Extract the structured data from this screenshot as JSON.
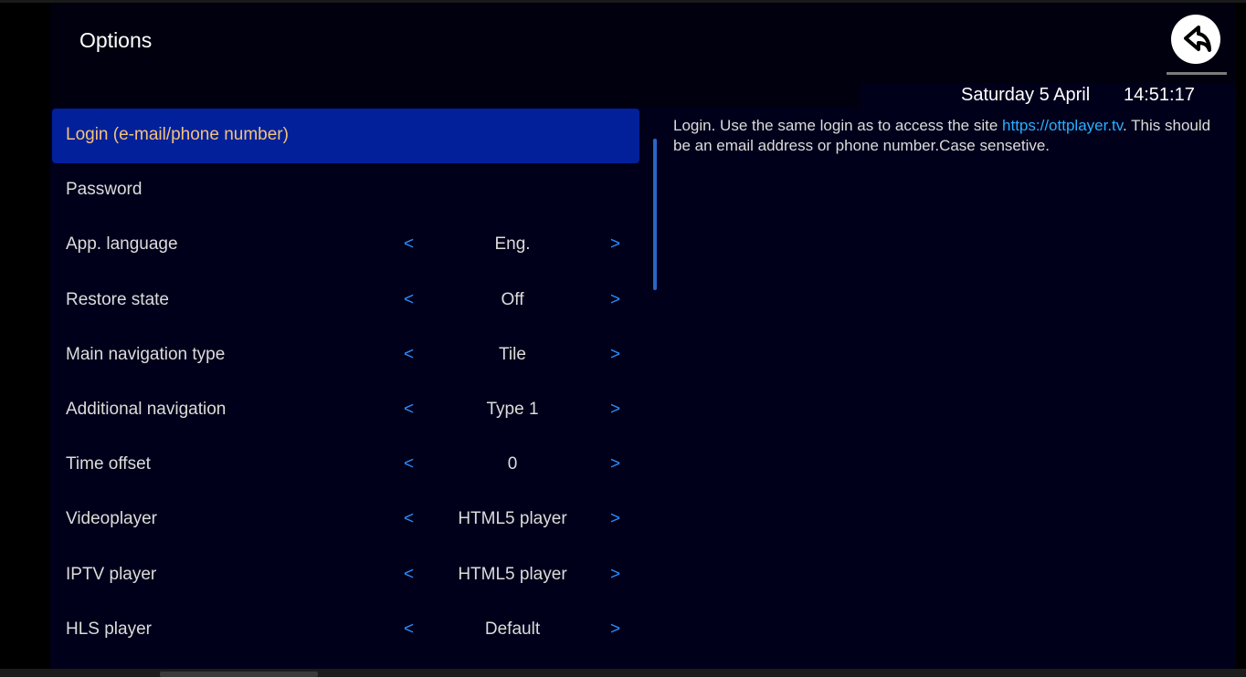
{
  "header": {
    "title": "Options",
    "date": "Saturday 5 April",
    "time": "14:51:17",
    "back_icon": "back-arrow-icon"
  },
  "settings": [
    {
      "label": "Login (e-mail/phone number)",
      "value": null,
      "selected": true
    },
    {
      "label": "Password",
      "value": null,
      "selected": false
    },
    {
      "label": "App. language",
      "value": "Eng.",
      "selected": false
    },
    {
      "label": "Restore state",
      "value": "Off",
      "selected": false
    },
    {
      "label": "Main navigation type",
      "value": "Tile",
      "selected": false
    },
    {
      "label": "Additional navigation",
      "value": "Type 1",
      "selected": false
    },
    {
      "label": "Time offset",
      "value": "0",
      "selected": false
    },
    {
      "label": "Videoplayer",
      "value": "HTML5 player",
      "selected": false
    },
    {
      "label": "IPTV player",
      "value": "HTML5 player",
      "selected": false
    },
    {
      "label": "HLS player",
      "value": "Default",
      "selected": false
    }
  ],
  "arrows": {
    "prev": "<",
    "next": ">"
  },
  "description": {
    "text_before": "Login. Use the same login as to access the site ",
    "link": "https://ottplayer.tv",
    "text_after": ". This should be an email address or phone number.Case sensetive."
  },
  "colors": {
    "background": "#00001a",
    "selected_row": "#01209a",
    "selected_text": "#f4c27c",
    "arrow": "#2a8dff",
    "link": "#2ab0ff"
  }
}
